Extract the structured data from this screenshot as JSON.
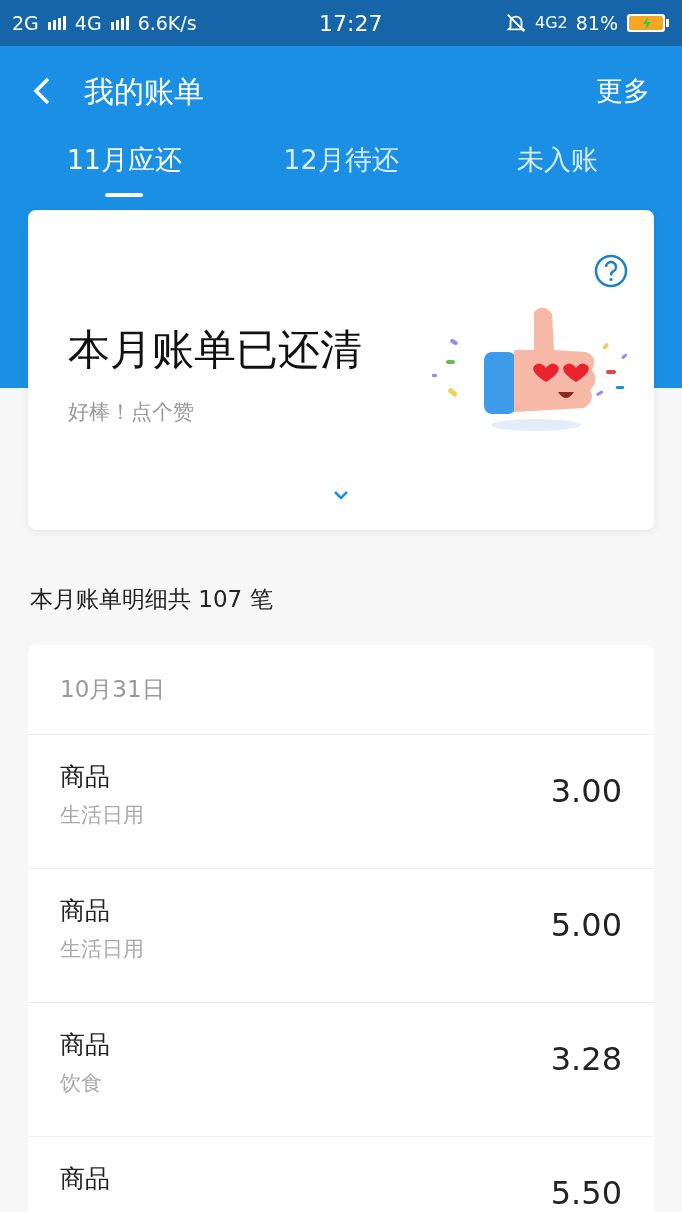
{
  "status_bar": {
    "left": [
      "2G",
      "4G",
      "6.6K/s"
    ],
    "time": "17:27",
    "network": "4G2",
    "battery": "81%"
  },
  "nav": {
    "title": "我的账单",
    "action": "更多"
  },
  "tabs": [
    {
      "label": "11月应还",
      "selected": true
    },
    {
      "label": "12月待还",
      "selected": false
    },
    {
      "label": "未入账",
      "selected": false
    }
  ],
  "summary": {
    "title": "本月账单已还清",
    "subtitle": "好棒！点个赞"
  },
  "detail_heading": "本月账单明细共 107 笔",
  "date": "10月31日",
  "transactions": [
    {
      "name": "商品",
      "category": "生活日用",
      "amount": "3.00"
    },
    {
      "name": "商品",
      "category": "生活日用",
      "amount": "5.00"
    },
    {
      "name": "商品",
      "category": "饮食",
      "amount": "3.28"
    },
    {
      "name": "商品",
      "amount": "5.50"
    }
  ]
}
